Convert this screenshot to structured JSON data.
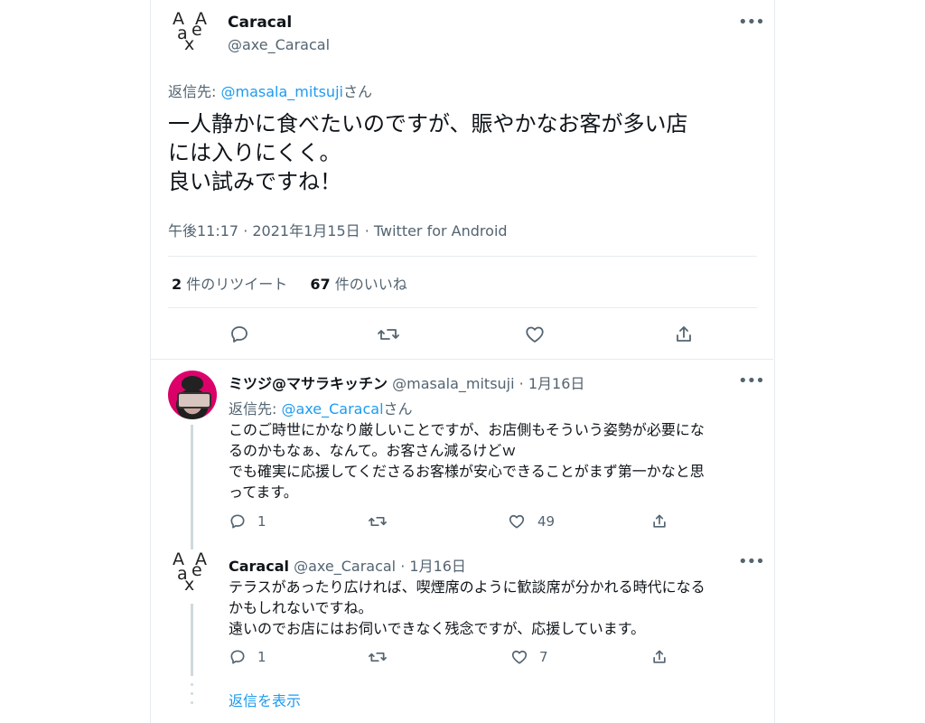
{
  "main_tweet": {
    "name": "Caracal",
    "handle": "@axe_Caracal",
    "reply_label": "返信先:",
    "reply_to": "@masala_mitsuji",
    "reply_suffix": "さん",
    "lines": [
      "一人静かに食べたいのですが、賑やかなお客が多い店",
      "には入りにくく。",
      "良い試みですね！"
    ],
    "meta": "午後11:17 · 2021年1月15日 · Twitter for Android",
    "retweets_count": "2",
    "retweets_label": "件のリツイート",
    "likes_count": "67",
    "likes_label": "件のいいね"
  },
  "reply1": {
    "name": "ミツジ@マサラキッチン",
    "handle": "@masala_mitsuji",
    "date": "· 1月16日",
    "reply_label": "返信先:",
    "reply_to": "@axe_Caracal",
    "reply_suffix": "さん",
    "lines": [
      "このご時世にかなり厳しいことですが、お店側もそういう姿勢が必要にな",
      "るのかもなぁ、なんて。お客さん減るけどｗ",
      "でも確実に応援してくださるお客様が安心できることがまず第一かなと思",
      "ってます。"
    ],
    "reply_count": "1",
    "like_count": "49"
  },
  "reply2": {
    "name": "Caracal",
    "handle": "@axe_Caracal",
    "date": "· 1月16日",
    "lines": [
      "テラスがあったり広ければ、喫煙席のように歓談席が分かれる時代になる",
      "かもしれないですね。",
      "遠いのでお店にはお伺いできなく残念ですが、応援しています。"
    ],
    "reply_count": "1",
    "like_count": "7"
  },
  "show_replies": "返信を表示",
  "logo_letters": [
    "A",
    "A",
    "a",
    "e",
    "x"
  ],
  "more_glyph": "•••",
  "icons": [
    "reply-icon",
    "retweet-icon",
    "like-icon",
    "share-icon",
    "more-icon"
  ],
  "colors": {
    "link": "#1d9bf0",
    "secondary_text": "#536471",
    "divider": "#e6ecf0",
    "thread_line": "#cfd9de"
  }
}
